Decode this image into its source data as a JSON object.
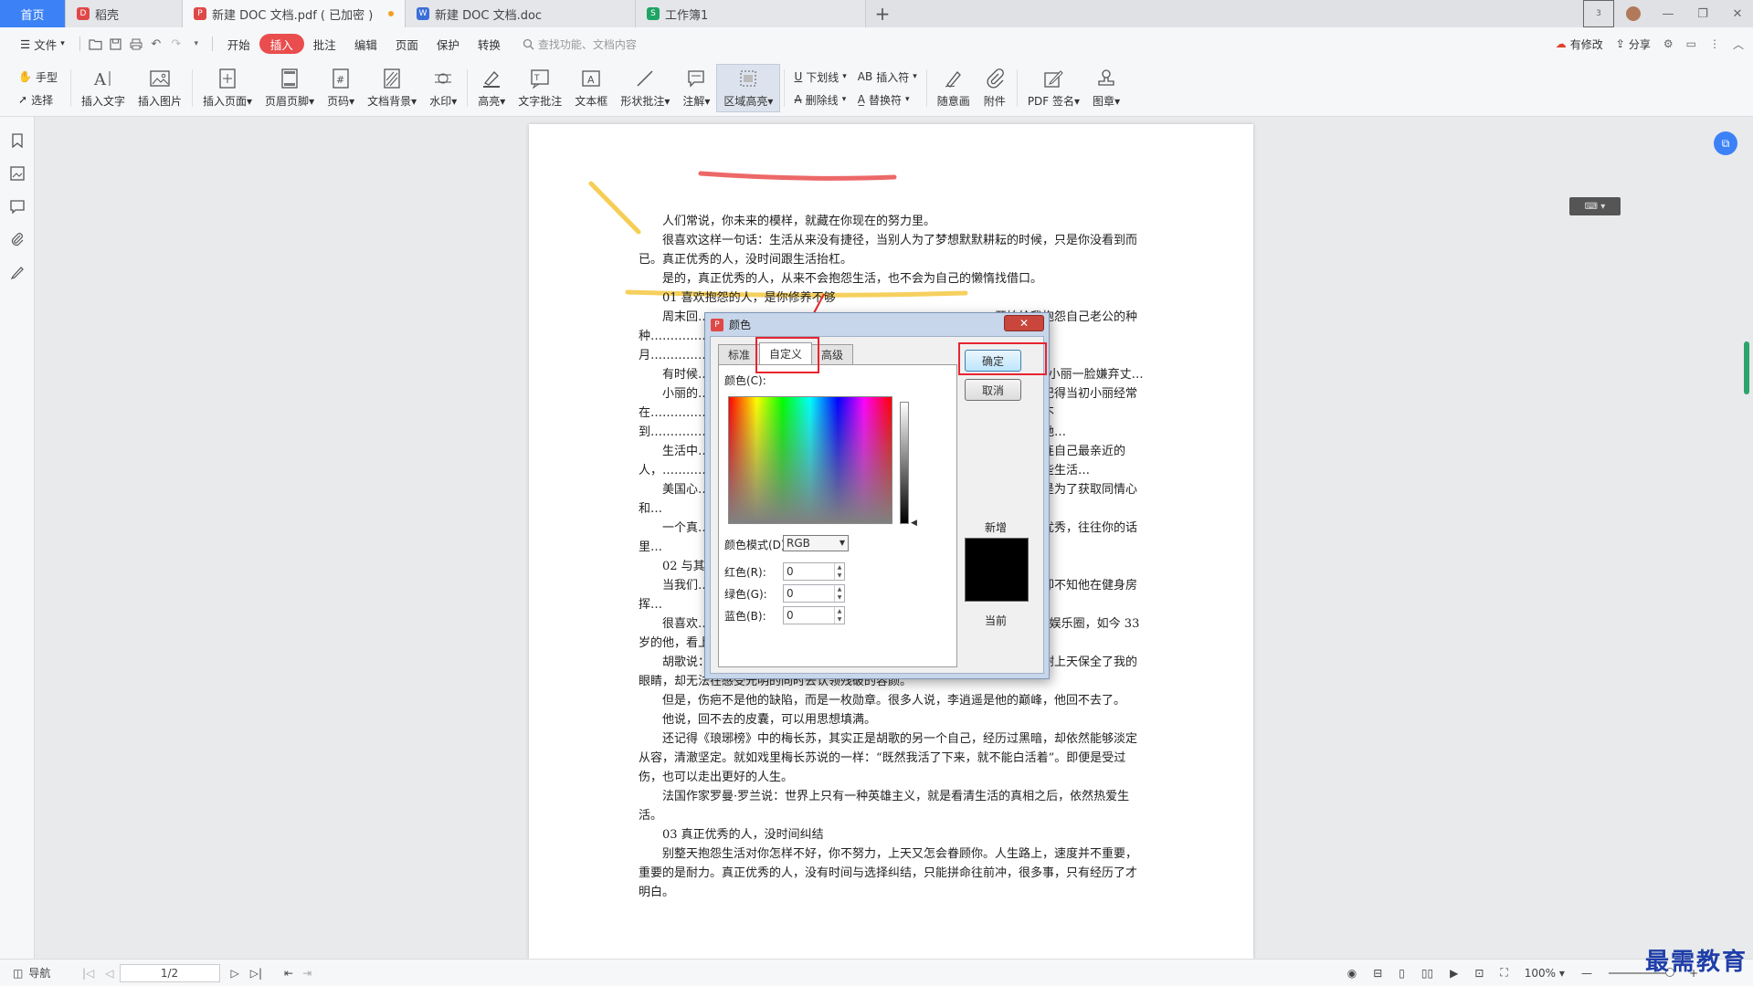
{
  "tabs": [
    {
      "label": "首页",
      "type": "home"
    },
    {
      "label": "稻壳",
      "icon_color": "#e04848"
    },
    {
      "label": "新建 DOC 文档.pdf ( 已加密 )",
      "icon_color": "#e04848",
      "active": true
    },
    {
      "label": "新建 DOC 文档.doc",
      "icon_color": "#3b6ed6"
    },
    {
      "label": "工作簿1",
      "icon_color": "#1fa463"
    }
  ],
  "window_badge": "3",
  "menubar": {
    "file": "文件",
    "items": [
      "开始",
      "插入",
      "批注",
      "编辑",
      "页面",
      "保护",
      "转换"
    ],
    "active": "插入",
    "search_placeholder": "查找功能、文档内容",
    "right": [
      "有修改",
      "分享"
    ]
  },
  "ribbon": {
    "hand": "手型",
    "select": "选择",
    "buttons": [
      {
        "label": "插入文字",
        "icon": "text-insert-icon"
      },
      {
        "label": "插入图片",
        "icon": "image-icon"
      },
      {
        "label": "插入页面",
        "icon": "add-page-icon",
        "dropdown": true
      },
      {
        "label": "页眉页脚",
        "icon": "header-footer-icon",
        "dropdown": true
      },
      {
        "label": "页码",
        "icon": "page-number-icon",
        "dropdown": true
      },
      {
        "label": "文档背景",
        "icon": "background-icon",
        "dropdown": true
      },
      {
        "label": "水印",
        "icon": "watermark-icon",
        "dropdown": true
      },
      {
        "label": "高亮",
        "icon": "highlight-icon",
        "dropdown": true
      },
      {
        "label": "文字批注",
        "icon": "text-comment-icon"
      },
      {
        "label": "文本框",
        "icon": "textbox-icon"
      },
      {
        "label": "形状批注",
        "icon": "shape-comment-icon",
        "dropdown": true
      },
      {
        "label": "注解",
        "icon": "annotation-icon",
        "dropdown": true
      },
      {
        "label": "区域高亮",
        "icon": "area-highlight-icon",
        "dropdown": true,
        "selected": true
      }
    ],
    "stack1": [
      "下划线",
      "删除线"
    ],
    "stack2": [
      "插入符",
      "替换符"
    ],
    "buttons2": [
      {
        "label": "随意画",
        "icon": "freehand-icon"
      },
      {
        "label": "附件",
        "icon": "attachment-icon"
      },
      {
        "label": "PDF 签名",
        "icon": "signature-icon",
        "dropdown": true
      },
      {
        "label": "图章",
        "icon": "stamp-icon",
        "dropdown": true
      }
    ]
  },
  "document": {
    "paragraphs": [
      {
        "text": "人们常说，你未来的模样，就藏在你现在的努力里。",
        "indent": true
      },
      {
        "text": "很喜欢这样一句话：生活从来没有捷径，当别人为了梦想默默耕耘的时候，只是你没看到而已。真正优秀的人，没时间跟生活抬杠。",
        "indent": true
      },
      {
        "text": "是的，真正优秀的人，从来不会抱怨生活，也不会为自己的懒惰找借口。",
        "indent": true
      },
      {
        "text": "01  喜欢抱怨的人，是你修养不够",
        "indent": true
      },
      {
        "text": "周末回…………………………………………………………………开始给我抱怨自己老公的种种…………………………………………………………出去玩。而自己的老公每月…………………………………………………………讨价还价。",
        "indent": true
      },
      {
        "text": "有时候…………………………………………………………………了”。看着小丽一脸嫌弃丈…",
        "indent": true
      },
      {
        "text": "小丽的…………………………………………………………………的好。还记得当初小丽经常在…………………………………………………………个好老公。可现在结婚还不到…………………………………………………………一笑，还是一如既往的对她…",
        "indent": true
      },
      {
        "text": "生活中…………………………………………………………………抱怨，就连自己最亲近的人，…………………………………………………………一些琐事，是爱人的一些生活…",
        "indent": true
      },
      {
        "text": "美国心…………………………………………………………………质，其实是为了获取同情心和…",
        "indent": true
      },
      {
        "text": "一个真…………………………………………………………………自己不够优秀，往往你的话里…",
        "indent": true
      },
      {
        "text": "02  与其…",
        "indent": true
      },
      {
        "text": "当我们…………………………………………………………………身材好，却不知他在健身房挥…",
        "indent": true
      },
      {
        "text": "很喜欢………………………………………………………………，25 岁回归娱乐圈，如今 33 岁的他，看上去更加成熟、稳重。",
        "indent": true
      },
      {
        "text": "胡歌说：我幸运的是最先找回了生命，却看着另一个生命逐渐远去；我感谢上天保全了我的眼睛，却无法在感受光明的同时去认领残破的容颜。",
        "indent": true
      },
      {
        "text": "但是，伤疤不是他的缺陷，而是一枚勋章。很多人说，李逍遥是他的巅峰，他回不去了。",
        "indent": true
      },
      {
        "text": "他说，回不去的皮囊，可以用思想填满。",
        "indent": true
      },
      {
        "text": "还记得《琅琊榜》中的梅长苏，其实正是胡歌的另一个自己，经历过黑暗，却依然能够淡定从容，清澈坚定。就如戏里梅长苏说的一样：“既然我活了下来，就不能白活着”。即便是受过伤，也可以走出更好的人生。",
        "indent": true
      },
      {
        "text": "法国作家罗曼·罗兰说：世界上只有一种英雄主义，就是看清生活的真相之后，依然热爱生活。",
        "indent": true
      },
      {
        "text": "03  真正优秀的人，没时间纠结",
        "indent": true
      },
      {
        "text": "别整天抱怨生活对你怎样不好，你不努力，上天又怎会眷顾你。人生路上，速度并不重要，重要的是耐力。真正优秀的人，没有时间与选择纠结，只能拼命往前冲，很多事，只有经历了才明白。",
        "indent": true
      }
    ]
  },
  "color_dialog": {
    "title": "颜色",
    "close_label": "✕",
    "tabs": [
      "标准",
      "自定义",
      "高级"
    ],
    "active_tab": "自定义",
    "color_label": "颜色(C):",
    "mode_label": "颜色模式(D)",
    "mode_value": "RGB",
    "red_label": "红色(R):",
    "green_label": "绿色(G):",
    "blue_label": "蓝色(B):",
    "red_value": "0",
    "green_value": "0",
    "blue_value": "0",
    "ok_label": "确定",
    "cancel_label": "取消",
    "new_label": "新增",
    "current_label": "当前",
    "current_color": "#000000"
  },
  "statusbar": {
    "nav_label": "导航",
    "page_value": "1/2",
    "zoom": "100%"
  },
  "watermark": "最需教育",
  "colors": {
    "accent": "#3c82f6",
    "insert_tab": "#ea4d4d",
    "highlight_line_red": "#ea4d4d",
    "highlight_line_yellow": "#f5c842",
    "callout_red": "#e8252f"
  }
}
